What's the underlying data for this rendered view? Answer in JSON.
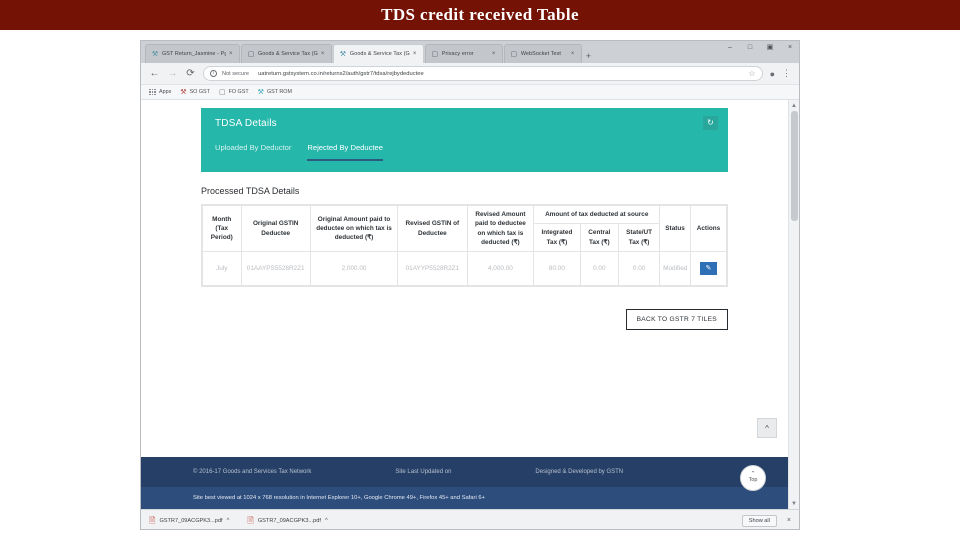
{
  "slide": {
    "title": "TDS  credit received Table",
    "banner_color": "#741206"
  },
  "browser": {
    "tabs": [
      {
        "label": "GST Return_Jasmine - Pg",
        "favicon": "gst-icon",
        "active": false
      },
      {
        "label": "Goods & Service Tax (G",
        "favicon": "page-icon",
        "active": false
      },
      {
        "label": "Goods & Service Tax (G",
        "favicon": "gst-icon",
        "active": true
      },
      {
        "label": "Privacy error",
        "favicon": "page-icon",
        "active": false
      },
      {
        "label": "WebSocket Test",
        "favicon": "page-icon",
        "active": false
      }
    ],
    "new_tab_label": "+",
    "tab_close_label": "×",
    "window_controls": [
      {
        "name": "minimize-button",
        "glyph": "–"
      },
      {
        "name": "maximize-button",
        "glyph": "□"
      },
      {
        "name": "restore-button",
        "glyph": "▣"
      },
      {
        "name": "close-button",
        "glyph": "×"
      }
    ],
    "nav": {
      "back": "←",
      "forward": "→",
      "reload": "⟳"
    },
    "omnibox": {
      "security_label": "Not secure",
      "url": "uatreturn.gstsystem.co.in/returns2/auth/gstr7/tdsa/rejbydeductee",
      "star": "☆",
      "profile": "●",
      "menu": "⋮"
    },
    "bookmarks": [
      {
        "label": "Apps",
        "icon": "apps-grid-icon"
      },
      {
        "label": "SO GST",
        "icon": "gst-icon"
      },
      {
        "label": "FO GST",
        "icon": "page-icon"
      },
      {
        "label": "GST ROM",
        "icon": "gst-icon"
      }
    ],
    "downloads": {
      "files": [
        {
          "name": "GSTR7_09ACGPK3...pdf",
          "icon": "pdf-icon",
          "caret": "^"
        },
        {
          "name": "GSTR7_09ACGPK3...pdf",
          "icon": "pdf-icon",
          "caret": "^"
        }
      ],
      "show_all_label": "Show all",
      "close_label": "×"
    }
  },
  "app": {
    "header": {
      "title": "TDSA Details",
      "refresh_icon": "↻"
    },
    "tabs": [
      {
        "label": "Uploaded By Deductor",
        "active": false
      },
      {
        "label": "Rejected By Deductee",
        "active": true
      }
    ],
    "section_title": "Processed TDSA Details",
    "table": {
      "group_header": "Amount of tax deducted at source",
      "headers": {
        "month": "Month (Tax Period)",
        "original_gstin": "Original GSTIN Deductee",
        "original_amount": "Original Amount paid to deductee on which tax is deducted (₹)",
        "revised_gstin": "Revised GSTIN of Deductee",
        "revised_amount": "Revised Amount paid to deductee on which tax is deducted (₹)",
        "integrated_tax": "Integrated Tax (₹)",
        "central_tax": "Central Tax (₹)",
        "state_tax": "State/UT Tax (₹)",
        "status": "Status",
        "actions": "Actions"
      },
      "rows": [
        {
          "month": "July",
          "original_gstin": "01AAYPS5528R2Z1",
          "original_amount": "2,000.00",
          "revised_gstin": "01AYYP5528R2Z1",
          "revised_amount": "4,000.00",
          "integrated_tax": "80.00",
          "central_tax": "0.00",
          "state_tax": "0.00",
          "status": "Modified",
          "action_icon": "✎"
        }
      ]
    },
    "back_button": "BACK TO GSTR 7 TILES",
    "scroll_up_icon": "^",
    "top_button": {
      "caret": "⌃",
      "label": "Top"
    },
    "footer": {
      "copyright": "© 2016-17 Goods and Services Tax Network",
      "last_updated": "Site Last Updated on",
      "developed_by": "Designed & Developed by GSTN",
      "browser_note": "Site best viewed at 1024 x 768 resolution in Internet Explorer 10+, Google Chrome 49+, Firefox 45+ and Safari 6+"
    }
  },
  "colors": {
    "teal": "#26b7ab",
    "footer_dark": "#253f66",
    "footer_light": "#2d4d7d",
    "edit_blue": "#2f6fb5"
  }
}
